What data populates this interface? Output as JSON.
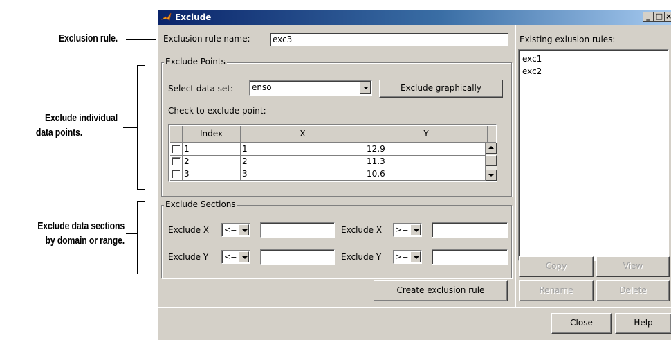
{
  "annotations": {
    "rule": "Exclusion rule.",
    "points_line1": "Exclude individual",
    "points_line2": "data points.",
    "sections_line1": "Exclude data sections",
    "sections_line2": "by domain or range."
  },
  "window": {
    "title": "Exclude",
    "minimize": "_",
    "maximize": "□",
    "close": "×"
  },
  "rule_name": {
    "label": "Exclusion rule name:",
    "value": "exc3"
  },
  "exclude_points": {
    "legend": "Exclude Points",
    "dataset_label": "Select data set:",
    "dataset_value": "enso",
    "graphically_button": "Exclude graphically",
    "check_label": "Check to exclude point:",
    "columns": [
      "Index",
      "X",
      "Y"
    ],
    "rows": [
      {
        "index": "1",
        "x": "1",
        "y": "12.9"
      },
      {
        "index": "2",
        "x": "2",
        "y": "11.3"
      },
      {
        "index": "3",
        "x": "3",
        "y": "10.6"
      }
    ]
  },
  "exclude_sections": {
    "legend": "Exclude Sections",
    "x_label": "Exclude X",
    "y_label": "Exclude Y",
    "le_op": "<=",
    "ge_op": ">="
  },
  "create_button": "Create exclusion rule",
  "existing": {
    "label": "Existing exlusion rules:",
    "items": [
      "exc1",
      "exc2"
    ],
    "copy": "Copy",
    "view": "View",
    "rename": "Rename",
    "delete": "Delete"
  },
  "footer": {
    "close": "Close",
    "help": "Help"
  },
  "colors": {
    "dialog_bg": "#d4d0c8",
    "titlebar_start": "#0a246a",
    "titlebar_end": "#a6caf0",
    "disabled_text": "#a0a0a0"
  }
}
